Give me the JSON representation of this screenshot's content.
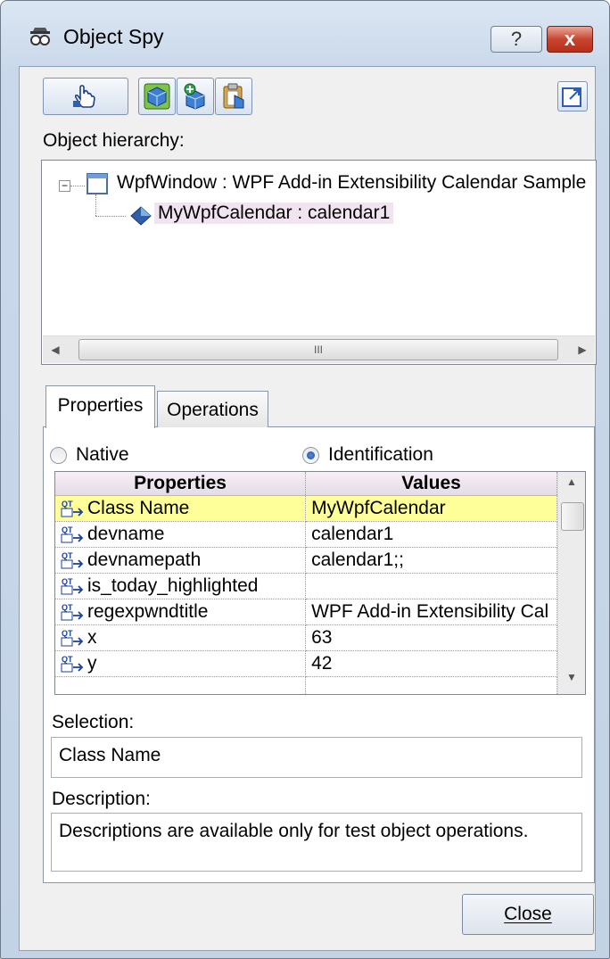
{
  "window": {
    "title": "Object Spy",
    "help_label": "?",
    "close_glyph": "x"
  },
  "toolbar": {
    "pointer_icon": "pointing-hand-icon",
    "highlight_icon": "highlight-object-icon",
    "add_icon": "add-object-icon",
    "clipboard_icon": "copy-to-clipboard-icon",
    "stay_on_top_icon": "stay-on-top-icon"
  },
  "hierarchy": {
    "label": "Object hierarchy:",
    "nodes": [
      {
        "text": "WpfWindow : WPF Add-in Extensibility Calendar Sample",
        "icon": "window-icon",
        "expander": "−"
      },
      {
        "text": "MyWpfCalendar : calendar1",
        "icon": "wpf-object-icon"
      }
    ],
    "scroll_thumb_label": "III"
  },
  "tabs": {
    "properties": "Properties",
    "operations": "Operations"
  },
  "radios": {
    "native": "Native",
    "identification": "Identification",
    "selected": "Identification"
  },
  "grid": {
    "headers": {
      "properties": "Properties",
      "values": "Values"
    },
    "rows": [
      {
        "name": "Class Name",
        "value": "MyWpfCalendar"
      },
      {
        "name": "devname",
        "value": "calendar1"
      },
      {
        "name": "devnamepath",
        "value": "calendar1;;"
      },
      {
        "name": "is_today_highlighted",
        "value": ""
      },
      {
        "name": "regexpwndtitle",
        "value": "WPF Add-in Extensibility Cal"
      },
      {
        "name": "x",
        "value": "63"
      },
      {
        "name": "y",
        "value": "42"
      }
    ],
    "row_icon": "identification-property-icon"
  },
  "selection": {
    "label": "Selection:",
    "value": "Class Name"
  },
  "description": {
    "label": "Description:",
    "value": "Descriptions are available only for test object operations."
  },
  "footer": {
    "close_label": "Close"
  },
  "colors": {
    "selected_row": "#ffff99",
    "title_bar": "#c9d8ea",
    "close_button": "#c8452f"
  }
}
